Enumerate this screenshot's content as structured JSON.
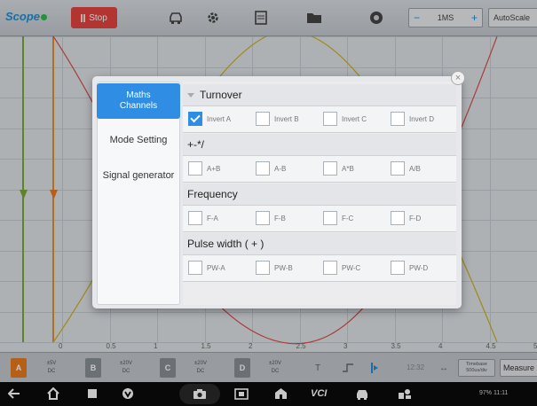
{
  "app": {
    "title": "Scope"
  },
  "toolbar": {
    "stop_label": "Stop",
    "timebase_minus": "−",
    "timebase_value": "1MS",
    "timebase_plus": "+",
    "autoscale_label": "AutoScale"
  },
  "scope": {
    "x_ticks": [
      "0",
      "0.5",
      "1",
      "1.5",
      "2",
      "2.5",
      "3",
      "3.5",
      "4",
      "4.5",
      "5ms"
    ],
    "colors": {
      "channel_a": "#e87a1e",
      "channel_b": "#6f9a2e",
      "wave_yellow": "#c9b022",
      "wave_red": "#d94f4f"
    }
  },
  "dialog": {
    "tabs": [
      {
        "label": "Maths Channels",
        "active": true
      },
      {
        "label": "Mode Setting",
        "active": false
      },
      {
        "label": "Signal generator",
        "active": false
      }
    ],
    "sections": [
      {
        "title": "Turnover",
        "options": [
          {
            "label": "Invert A",
            "checked": true
          },
          {
            "label": "Invert B",
            "checked": false
          },
          {
            "label": "Invert C",
            "checked": false
          },
          {
            "label": "Invert D",
            "checked": false
          }
        ]
      },
      {
        "title": "+-*/",
        "options": [
          {
            "label": "A+B",
            "checked": false
          },
          {
            "label": "A-B",
            "checked": false
          },
          {
            "label": "A*B",
            "checked": false
          },
          {
            "label": "A/B",
            "checked": false
          }
        ]
      },
      {
        "title": "Frequency",
        "options": [
          {
            "label": "F-A",
            "checked": false
          },
          {
            "label": "F-B",
            "checked": false
          },
          {
            "label": "F-C",
            "checked": false
          },
          {
            "label": "F-D",
            "checked": false
          }
        ]
      },
      {
        "title": "Pulse width ( + )",
        "options": [
          {
            "label": "PW-A",
            "checked": false
          },
          {
            "label": "PW-B",
            "checked": false
          },
          {
            "label": "PW-C",
            "checked": false
          },
          {
            "label": "PW-D",
            "checked": false
          }
        ]
      }
    ]
  },
  "bottombar": {
    "channels": [
      {
        "key": "A",
        "v1": "±5V",
        "v2": "DC",
        "color": "#e87a1e"
      },
      {
        "key": "B",
        "v1": "±20V",
        "v2": "DC",
        "color": "#8a9096"
      },
      {
        "key": "C",
        "v1": "±20V",
        "v2": "DC",
        "color": "#8a9096"
      },
      {
        "key": "D",
        "v1": "±20V",
        "v2": "DC",
        "color": "#8a9096"
      }
    ],
    "time": "12:32",
    "timebase_l1": "Timebase",
    "timebase_l2": "500us/div",
    "measure_label": "Measure"
  },
  "navbar": {
    "vci_label": "VCI",
    "status": "97% 11:11"
  }
}
